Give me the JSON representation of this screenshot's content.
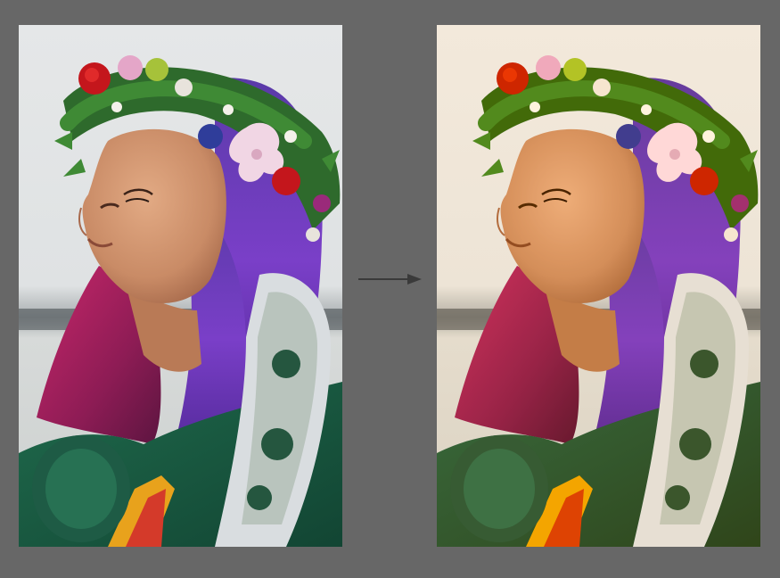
{
  "comparison": {
    "before": {
      "label": "",
      "style": "original"
    },
    "after": {
      "label": "",
      "style": "edited"
    },
    "arrow_icon": "arrow-right-icon"
  },
  "colors": {
    "background": "#676767",
    "arrow": "#3a3a3a"
  }
}
